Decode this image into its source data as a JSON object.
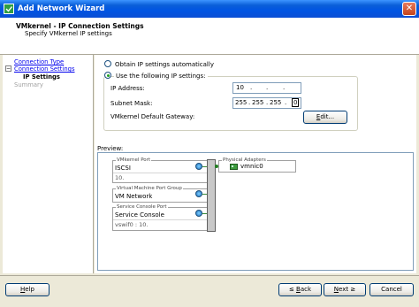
{
  "window": {
    "title": "Add Network Wizard",
    "close_glyph": "✕"
  },
  "header": {
    "title": "VMkernel - IP Connection Settings",
    "subtitle": "Specify VMkernel IP settings"
  },
  "sidebar": {
    "collapse_glyph": "−",
    "steps": [
      {
        "label": "Connection Type",
        "state": "link"
      },
      {
        "label": "Connection Settings",
        "state": "link"
      },
      {
        "label": "IP Settings",
        "state": "current"
      },
      {
        "label": "Summary",
        "state": "future"
      }
    ]
  },
  "ip": {
    "obtain_auto_label": "Obtain IP settings automatically",
    "use_following_label": "Use the following IP settings:",
    "selected_option": "use_following",
    "address_label": "IP Address:",
    "address_octets": [
      "10",
      ".",
      ".",
      "."
    ],
    "mask_label": "Subnet Mask:",
    "mask_octets": [
      "255",
      ".",
      "255",
      ".",
      "255",
      ".",
      "0"
    ],
    "gateway_label": "VMkernel Default Gateway:",
    "edit_button": {
      "underlined": "E",
      "rest": "dit..."
    }
  },
  "preview": {
    "label": "Preview:",
    "vmkernel_port": {
      "caption": "VMkernel Port",
      "name": "ISCSI",
      "ip": "10."
    },
    "vm_port_group": {
      "caption": "Virtual Machine Port Group",
      "name": "VM Network"
    },
    "service_console": {
      "caption": "Service Console Port",
      "name": "Service Console",
      "detail": "vswif0 : 10."
    },
    "physical_adapters": {
      "caption": "Physical Adapters",
      "nic": "vmnic0"
    }
  },
  "footer": {
    "help": {
      "underlined": "H",
      "rest": "elp"
    },
    "back": {
      "prefix": "≤ ",
      "underlined": "B",
      "rest": "ack"
    },
    "next": {
      "prefix": "",
      "underlined": "N",
      "rest": "ext ≥"
    },
    "cancel": "Cancel"
  },
  "colors": {
    "titlebar": "#0054e3",
    "link": "#0000ee",
    "group_border": "#d0d0bf",
    "connector": "#3a8a3a"
  },
  "icons": [
    "wizard-icon",
    "close-icon",
    "port-icon",
    "nic-icon",
    "collapse-icon"
  ]
}
